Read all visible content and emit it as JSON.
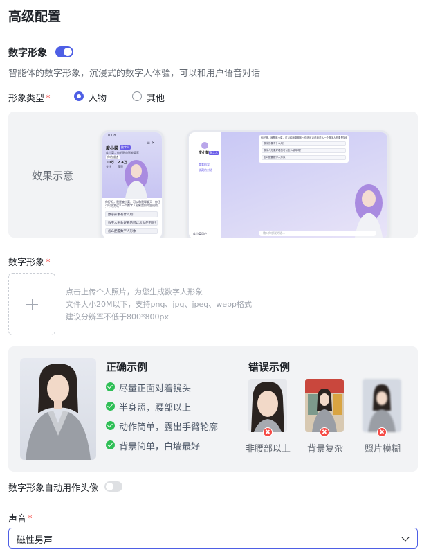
{
  "page": {
    "title": "高级配置"
  },
  "digital_human": {
    "title": "数字形象",
    "enabled": true,
    "description": "智能体的数字形象，沉浸式的数字人体验，可以和用户语音对话"
  },
  "avatar_type": {
    "label": "形象类型",
    "options": [
      {
        "label": "人物",
        "selected": true
      },
      {
        "label": "其他",
        "selected": false
      }
    ]
  },
  "preview": {
    "label": "效果示意",
    "phone": {
      "status_time": "10:08",
      "name": "度小菜",
      "tag": "数字人",
      "subtitle": "度小菜，你的贴心智能管家",
      "link": "你的描述",
      "stats": [
        {
          "value": "10万",
          "label": "关注"
        },
        {
          "value": "2.4万",
          "label": "获赞"
        }
      ],
      "greeting": "你好呀，我是度小菜，可以和我聊聊天～你还可以说我这么一个数字人形象是如何生成的，快来试试吧",
      "suggestions": [
        "数字形象有什么用？",
        "数字人形象好看的可以怎么使用呀？",
        "怎么配置数字人形象"
      ]
    },
    "tablet": {
      "name": "度小菜",
      "tag": "数字人",
      "side_links": [
        "查看档案",
        "收藏的对话"
      ],
      "greeting": "你好呀，我是度小菜，可以和我聊聊天～你还可以说我这么一个数字人形象是如何生成的，快来试试吧",
      "suggestions": [
        "数字形象有什么用？",
        "数字人形象好看的可以怎么使用呀？",
        "怎么配置数字人形象"
      ],
      "input_placeholder": "输入你想说的话...",
      "user": "度小菜用户"
    }
  },
  "upload": {
    "label": "数字形象",
    "hints": [
      "点击上传个人照片，为您生成数字人形象",
      "文件大小20M以下，支持png、jpg、jpeg、webp格式",
      "建议分辨率不低于800*800px"
    ]
  },
  "examples": {
    "correct_title": "正确示例",
    "correct_items": [
      "尽量正面对着镜头",
      "半身照，腰部以上",
      "动作简单，露出手臂轮廓",
      "背景简单，白墙最好"
    ],
    "wrong_title": "错误示例",
    "wrong_items": [
      "非腰部以上",
      "背景复杂",
      "照片模糊"
    ]
  },
  "auto_avatar": {
    "label": "数字形象自动用作头像",
    "enabled": false
  },
  "voice": {
    "label": "声音",
    "value": "磁性男声"
  },
  "colors": {
    "accent": "#4e5fe5",
    "required": "#f54a45",
    "success": "#2fbf56",
    "panel": "#f2f3f5"
  }
}
